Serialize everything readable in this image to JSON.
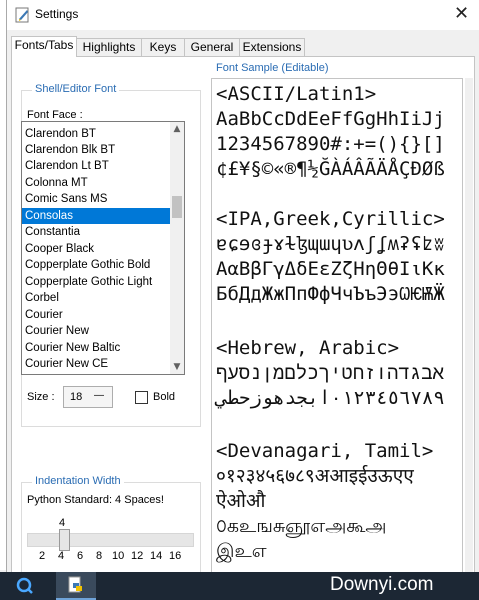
{
  "window": {
    "title": "Settings",
    "close_glyph": "✕"
  },
  "tabs": [
    {
      "label": "Fonts/Tabs",
      "active": true
    },
    {
      "label": "Highlights"
    },
    {
      "label": "Keys"
    },
    {
      "label": "General"
    },
    {
      "label": "Extensions"
    }
  ],
  "font_group": {
    "title": "Shell/Editor Font",
    "face_label": "Font Face :",
    "fonts": [
      "Clarendon BT",
      "Clarendon Blk BT",
      "Clarendon Lt BT",
      "Colonna MT",
      "Comic Sans MS",
      "Consolas",
      "Constantia",
      "Cooper Black",
      "Copperplate Gothic Bold",
      "Copperplate Gothic Light",
      "Corbel",
      "Courier",
      "Courier New",
      "Courier New Baltic",
      "Courier New CE"
    ],
    "selected_font": "Consolas",
    "size_label": "Size :",
    "size_value": "18",
    "bold_label": "Bold",
    "bold_checked": false
  },
  "indent_group": {
    "title": "Indentation Width",
    "description": "Python Standard: 4 Spaces!",
    "value": "4",
    "slider_value": 4,
    "ticks": [
      "2",
      "4",
      "6",
      "8",
      "10",
      "12",
      "14",
      "16"
    ]
  },
  "sample": {
    "title": "Font Sample (Editable)",
    "lines": [
      "<ASCII/Latin1>",
      "AaBbCcDdEeFfGgHhIiJj",
      "1234567890#:+=(){}[]",
      "¢£¥§©«®¶½ĞÀÁÂÃÄÅÇÐØß",
      "",
      "<IPA,Greek,Cyrillic>",
      "ɐɕɘɞɟɤɫɮɰɯɥʋʌʃʆʍʡʢʫʬ",
      "ΑαΒβΓγΔδΕεΖζΗηΘθΙιΚκ",
      "БбДдЖжПпФфЧчЪъЭэѠѤѬӜ",
      "",
      "<Hebrew, Arabic>",
      "אבגדהוזחטיךכלםמןנסעף",
      "٠١٢٣٤٥٦٧٨٩ابجدهوزحطي",
      "",
      "<Devanagari, Tamil>",
      "०१२३४५६७८९अआइईउऊएए",
      "ऐओऔ",
      "௦கஉஙசுஞூஎஅகூஅ",
      "இஉஎ"
    ]
  },
  "taskbar": {
    "watermark": "Downyi.com"
  },
  "colors": {
    "accent": "#0078d7",
    "group_title": "#2a6cb3",
    "taskbar": "#1c2734"
  }
}
